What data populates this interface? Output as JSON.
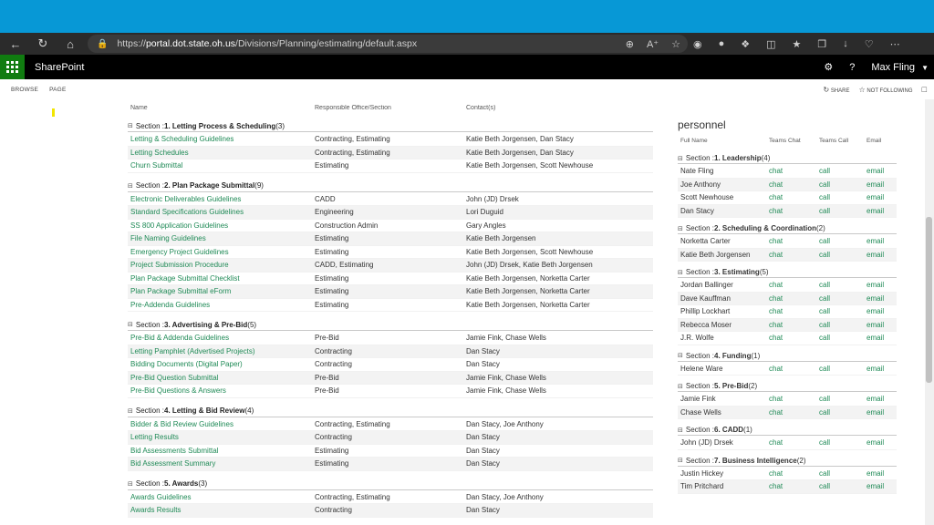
{
  "browser": {
    "url_prefix": "https://",
    "url_host": "portal.dot.state.oh.us",
    "url_path": "/Divisions/Planning/estimating/default.aspx"
  },
  "suite": {
    "app_name": "SharePoint",
    "help": "?",
    "user_name": "Max Fling"
  },
  "ribbon": {
    "tabs": [
      "BROWSE",
      "PAGE"
    ],
    "share": "SHARE",
    "not_following": "NOT FOLLOWING"
  },
  "documents": {
    "columns": [
      "Name",
      "Responsible Office/Section",
      "Contact(s)"
    ],
    "sections": [
      {
        "prefix": "Section : ",
        "title": "1. Letting Process & Scheduling",
        "count": "(3)",
        "rows": [
          [
            "Letting & Scheduling Guidelines",
            "Contracting, Estimating",
            "Katie Beth Jorgensen, Dan Stacy"
          ],
          [
            "Letting Schedules",
            "Contracting, Estimating",
            "Katie Beth Jorgensen, Dan Stacy"
          ],
          [
            "Churn Submittal",
            "Estimating",
            "Katie Beth Jorgensen, Scott Newhouse"
          ]
        ]
      },
      {
        "prefix": "Section : ",
        "title": "2. Plan Package Submittal",
        "count": "(9)",
        "rows": [
          [
            "Electronic Deliverables Guidelines",
            "CADD",
            "John (JD) Drsek"
          ],
          [
            "Standard Specifications Guidelines",
            "Engineering",
            "Lori Duguid"
          ],
          [
            "SS 800 Application Guidelines",
            "Construction Admin",
            "Gary Angles"
          ],
          [
            "File Naming Guidelines",
            "Estimating",
            "Katie Beth Jorgensen"
          ],
          [
            "Emergency Project Guidelines",
            "Estimating",
            "Katie Beth Jorgensen, Scott Newhouse"
          ],
          [
            "Project Submission Procedure",
            "CADD, Estimating",
            "John (JD) Drsek, Katie Beth Jorgensen"
          ],
          [
            "Plan Package Submittal Checklist",
            "Estimating",
            "Katie Beth Jorgensen, Norketta Carter"
          ],
          [
            "Plan Package Submittal eForm",
            "Estimating",
            "Katie Beth Jorgensen, Norketta Carter"
          ],
          [
            "Pre-Addenda Guidelines",
            "Estimating",
            "Katie Beth Jorgensen, Norketta Carter"
          ]
        ]
      },
      {
        "prefix": "Section : ",
        "title": "3. Advertising & Pre-Bid",
        "count": "(5)",
        "rows": [
          [
            "Pre-Bid & Addenda Guidelines",
            "Pre-Bid",
            "Jamie Fink, Chase Wells"
          ],
          [
            "Letting Pamphlet (Advertised Projects)",
            "Contracting",
            "Dan Stacy"
          ],
          [
            "Bidding Documents (Digital Paper)",
            "Contracting",
            "Dan Stacy"
          ],
          [
            "Pre-Bid Question Submittal",
            "Pre-Bid",
            "Jamie Fink, Chase Wells"
          ],
          [
            "Pre-Bid Questions & Answers",
            "Pre-Bid",
            "Jamie Fink, Chase Wells"
          ]
        ]
      },
      {
        "prefix": "Section : ",
        "title": "4. Letting & Bid Review",
        "count": "(4)",
        "rows": [
          [
            "Bidder & Bid Review Guidelines",
            "Contracting, Estimating",
            "Dan Stacy, Joe Anthony"
          ],
          [
            "Letting Results",
            "Contracting",
            "Dan Stacy"
          ],
          [
            "Bid Assessments Submittal",
            "Estimating",
            "Dan Stacy"
          ],
          [
            "Bid Assessment Summary",
            "Estimating",
            "Dan Stacy"
          ]
        ]
      },
      {
        "prefix": "Section : ",
        "title": "5. Awards",
        "count": "(3)",
        "rows": [
          [
            "Awards Guidelines",
            "Contracting, Estimating",
            "Dan Stacy, Joe Anthony"
          ],
          [
            "Awards Results",
            "Contracting",
            "Dan Stacy"
          ]
        ]
      }
    ]
  },
  "personnel": {
    "title": "personnel",
    "columns": [
      "Full Name",
      "Teams Chat",
      "Teams Call",
      "Email"
    ],
    "link_chat": "chat",
    "link_call": "call",
    "link_email": "email",
    "sections": [
      {
        "prefix": "Section : ",
        "title": "1. Leadership",
        "count": "(4)",
        "people": [
          "Nate Fling",
          "Joe Anthony",
          "Scott Newhouse",
          "Dan Stacy"
        ]
      },
      {
        "prefix": "Section : ",
        "title": "2. Scheduling & Coordination",
        "count": "(2)",
        "people": [
          "Norketta Carter",
          "Katie Beth Jorgensen"
        ]
      },
      {
        "prefix": "Section : ",
        "title": "3. Estimating",
        "count": "(5)",
        "people": [
          "Jordan Ballinger",
          "Dave Kauffman",
          "Phillip Lockhart",
          "Rebecca Moser",
          "J.R. Wolfe"
        ]
      },
      {
        "prefix": "Section : ",
        "title": "4. Funding",
        "count": "(1)",
        "people": [
          "Helene Ware"
        ]
      },
      {
        "prefix": "Section : ",
        "title": "5. Pre-Bid",
        "count": "(2)",
        "people": [
          "Jamie Fink",
          "Chase Wells"
        ]
      },
      {
        "prefix": "Section : ",
        "title": "6. CADD",
        "count": "(1)",
        "people": [
          "John (JD) Drsek"
        ]
      },
      {
        "prefix": "Section : ",
        "title": "7. Business Intelligence",
        "count": "(2)",
        "people": [
          "Justin Hickey",
          "Tim Pritchard"
        ]
      }
    ]
  }
}
